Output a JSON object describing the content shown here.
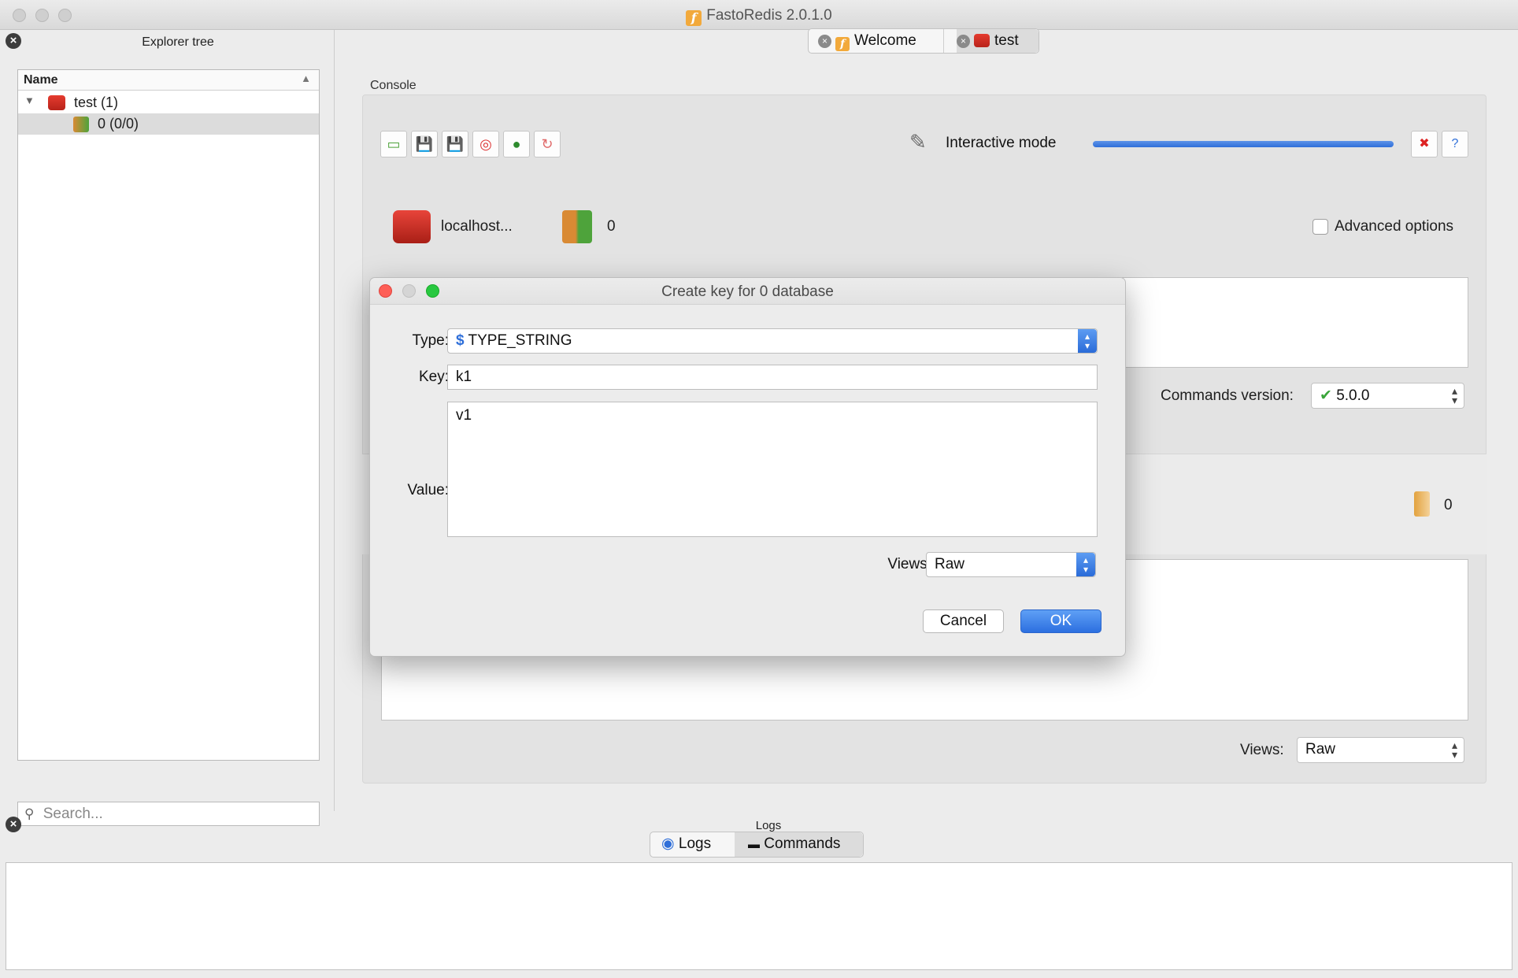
{
  "window": {
    "title": "FastoRedis 2.0.1.0"
  },
  "explorer": {
    "title": "Explorer tree",
    "column_name": "Name",
    "items": [
      {
        "label": "test (1)"
      },
      {
        "label": "0 (0/0)"
      }
    ],
    "search_placeholder": "Search..."
  },
  "tabs": [
    {
      "label": "Welcome"
    },
    {
      "label": "test"
    }
  ],
  "console": {
    "label": "Console",
    "interactive_label": "Interactive mode",
    "progress_fraction": 1.0,
    "server_label": "localhost...",
    "db_count": "0",
    "advanced_options_label": "Advanced options",
    "commands_version_label": "Commands version:",
    "commands_version_value": "5.0.0",
    "result_count": "0",
    "views_label": "Views:",
    "views_value": "Raw"
  },
  "logs": {
    "title": "Logs",
    "tabs": [
      {
        "label": "Logs"
      },
      {
        "label": "Commands"
      }
    ]
  },
  "dialog": {
    "title": "Create key for 0 database",
    "type_label": "Type:",
    "type_value": "TYPE_STRING",
    "key_label": "Key:",
    "key_value": "k1",
    "value_label": "Value:",
    "value_value": "v1",
    "views_label": "Views:",
    "views_value": "Raw",
    "cancel_label": "Cancel",
    "ok_label": "OK"
  },
  "colors": {
    "accent": "#2f6fd9",
    "redis_red": "#d42c22",
    "close_red": "#fe5f57",
    "minimize": "#febc2e",
    "maximize": "#28c840"
  }
}
